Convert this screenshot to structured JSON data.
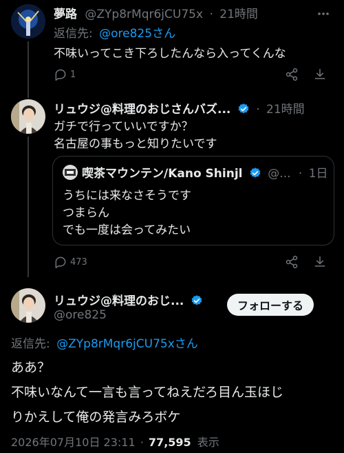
{
  "reply1": {
    "name": "夢路",
    "handle": "@ZYp8rMqr6jCU75x",
    "dot": "·",
    "time": "21時間",
    "reply_prefix": "返信先:",
    "reply_to": "@ore825さん",
    "text": "不味いってこき下ろしたんなら入ってくんな",
    "reply_count": "1"
  },
  "reply2": {
    "name": "リュウジ@料理のおじさんバズ...",
    "dot": "·",
    "time": "21時間",
    "text_line1": "ガチで行っていいですか？",
    "text_line2": "名古屋の事もっと知りたいです",
    "quote": {
      "name": "喫茶マウンテン/Kano Shinjl",
      "handle": "@...",
      "dot": "·",
      "time": "1日",
      "line1": "うちには来なさそうです",
      "line2": "つまらん",
      "line3": "でも一度は会ってみたい"
    },
    "reply_count": "473"
  },
  "main": {
    "name": "リュウジ@料理のおじ...",
    "handle": "@ore825",
    "follow_label": "フォローする",
    "reply_prefix": "返信先:",
    "reply_to": "@ZYp8rMqr6jCU75xさん",
    "line1": "ああ？",
    "line2": "不味いなんて一言も言ってねえだろ目ん玉ほじ",
    "line3": "りかえして俺の発言みろボケ",
    "date": "2026年07月10日 23:11",
    "dot": "·",
    "views": "77,595",
    "views_label": "表示"
  },
  "icons": {
    "more": "more-icon",
    "reply": "reply-icon",
    "share": "share-icon",
    "download": "download-icon",
    "verified": "verified-badge-icon"
  },
  "colors": {
    "background": "#000000",
    "link": "#1d9bf0",
    "muted": "#71767b",
    "verified": "#1d9bf0"
  }
}
